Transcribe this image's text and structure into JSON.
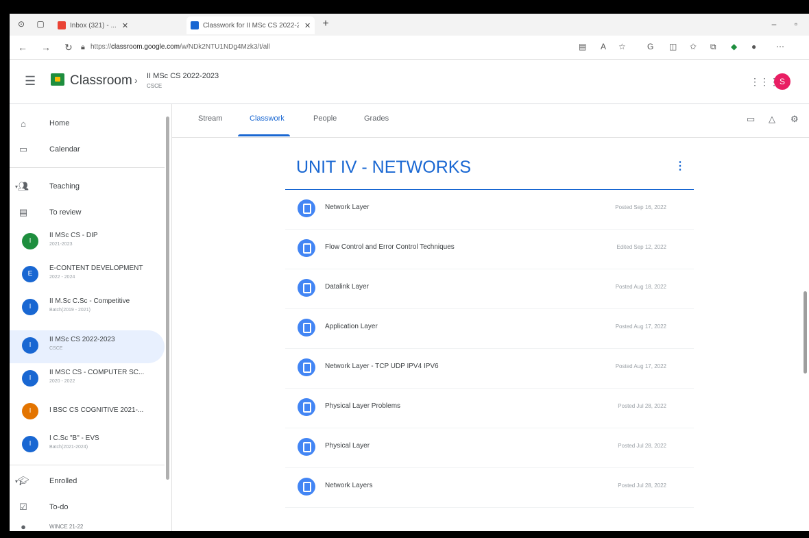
{
  "browser": {
    "tabs": [
      {
        "title": "Inbox (321) - ..."
      },
      {
        "title": "Classwork for II MSc CS 2022-2..."
      }
    ],
    "url_prefix": "https://",
    "url_domain": "classroom.google.com",
    "url_path": "/w/NDk2NTU1NDg4Mzk3/t/all"
  },
  "header": {
    "brand": "Classroom",
    "class_title": "II MSc CS 2022-2023",
    "class_section": "CSCE",
    "avatar_initial": "S"
  },
  "sidebar": {
    "home": "Home",
    "calendar": "Calendar",
    "teaching": "Teaching",
    "to_review": "To review",
    "classes": [
      {
        "name": "II MSc CS - DIP",
        "sub": "2021-2023",
        "initial": "I",
        "color": "#1e8e3e"
      },
      {
        "name": "E-CONTENT DEVELOPMENT",
        "sub": "2022 - 2024",
        "initial": "E",
        "color": "#1967d2"
      },
      {
        "name": "II M.Sc C.Sc - Competitive",
        "sub": "Batch(2019 - 2021)",
        "initial": "I",
        "color": "#1967d2"
      },
      {
        "name": "II MSc CS 2022-2023",
        "sub": "CSCE",
        "initial": "I",
        "color": "#1967d2"
      },
      {
        "name": "II MSC CS - COMPUTER SC...",
        "sub": "2020 - 2022",
        "initial": "I",
        "color": "#1967d2"
      },
      {
        "name": "I BSC CS COGNITIVE 2021-...",
        "sub": "",
        "initial": "I",
        "color": "#e37400"
      },
      {
        "name": "I C.Sc \"B\" - EVS",
        "sub": "Batch(2021-2024)",
        "initial": "I",
        "color": "#1967d2"
      }
    ],
    "enrolled": "Enrolled",
    "todo": "To-do",
    "partial": "WINCE 21-22"
  },
  "tabs": {
    "stream": "Stream",
    "classwork": "Classwork",
    "people": "People",
    "grades": "Grades"
  },
  "topic": {
    "title": "UNIT IV - NETWORKS",
    "items": [
      {
        "title": "Network Layer",
        "date": "Posted Sep 16, 2022"
      },
      {
        "title": "Flow Control and Error Control Techniques",
        "date": "Edited Sep 12, 2022"
      },
      {
        "title": "Datalink Layer",
        "date": "Posted Aug 18, 2022"
      },
      {
        "title": "Application Layer",
        "date": "Posted Aug 17, 2022"
      },
      {
        "title": "Network Layer - TCP UDP IPV4 IPV6",
        "date": "Posted Aug 17, 2022"
      },
      {
        "title": "Physical Layer Problems",
        "date": "Posted Jul 28, 2022"
      },
      {
        "title": "Physical Layer",
        "date": "Posted Jul 28, 2022"
      },
      {
        "title": "Network Layers",
        "date": "Posted Jul 28, 2022"
      }
    ]
  }
}
